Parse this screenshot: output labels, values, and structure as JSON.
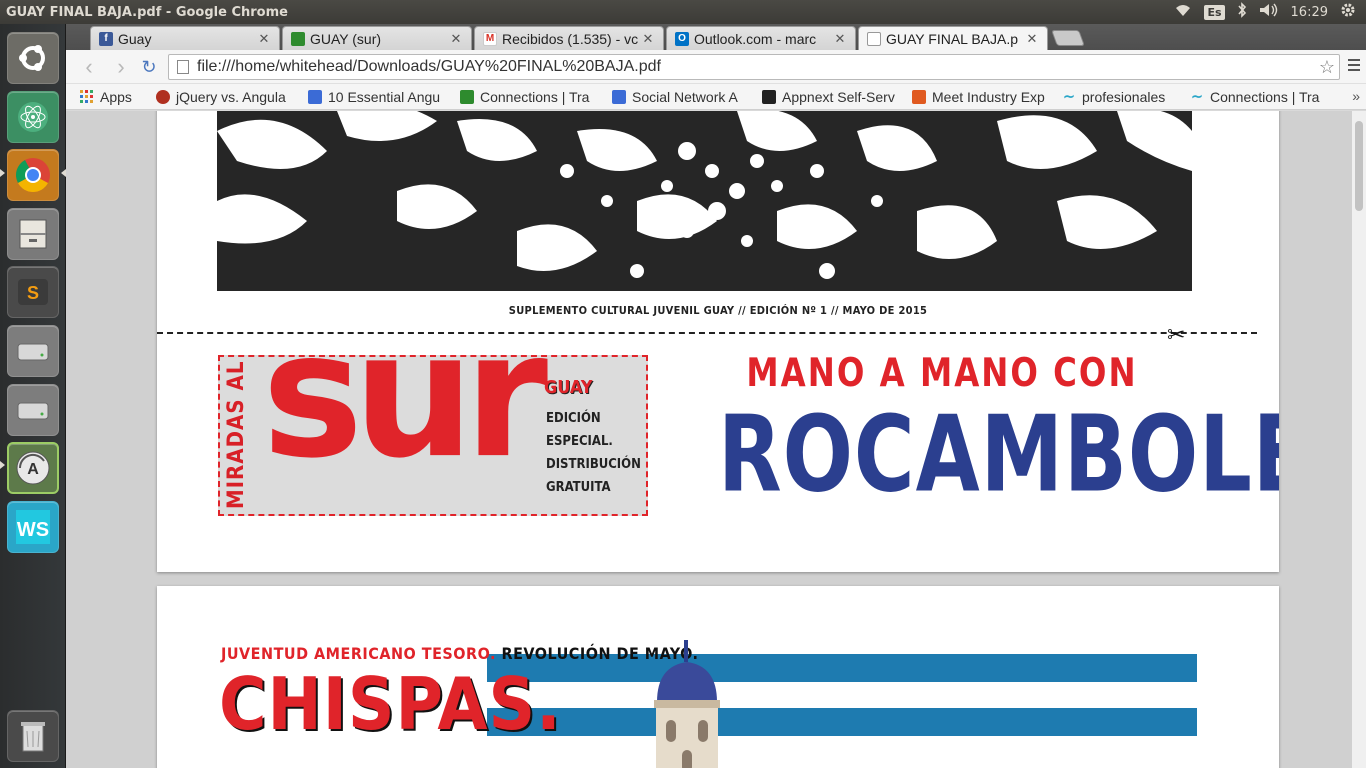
{
  "panel": {
    "window_title": "GUAY FINAL BAJA.pdf - Google Chrome",
    "keyboard_layout": "Es",
    "clock": "16:29",
    "indicator_icons": [
      "wifi-icon",
      "bluetooth-icon",
      "volume-icon",
      "settings-gear-icon"
    ]
  },
  "launcher": {
    "items": [
      {
        "name": "ubuntu-dash",
        "icon": "ubuntu-logo-icon"
      },
      {
        "name": "atom",
        "icon": "atom-icon"
      },
      {
        "name": "chrome",
        "icon": "chrome-icon"
      },
      {
        "name": "files",
        "icon": "file-cabinet-icon"
      },
      {
        "name": "sublime-text",
        "icon": "sublime-icon"
      },
      {
        "name": "drive-1",
        "icon": "hard-drive-icon"
      },
      {
        "name": "drive-2",
        "icon": "hard-drive-icon"
      },
      {
        "name": "software-updater",
        "icon": "updater-icon"
      },
      {
        "name": "webstorm",
        "icon": "webstorm-icon"
      },
      {
        "name": "trash",
        "icon": "trash-icon"
      }
    ]
  },
  "tabs": [
    {
      "label": "Guay",
      "favicon": "facebook-icon",
      "color": "#3b5998"
    },
    {
      "label": "GUAY (sur)",
      "favicon": "green-cube-icon",
      "color": "#2e8b2e"
    },
    {
      "label": "Recibidos (1.535) - vc",
      "favicon": "gmail-icon",
      "color": "#d93025"
    },
    {
      "label": "Outlook.com - marc",
      "favicon": "outlook-icon",
      "color": "#0072c6"
    },
    {
      "label": "GUAY FINAL BAJA.p",
      "favicon": "page-icon",
      "color": "#888888"
    }
  ],
  "toolbar": {
    "url": "file:///home/whitehead/Downloads/GUAY%20FINAL%20BAJA.pdf"
  },
  "bookmarks": [
    {
      "label": "Apps",
      "icon": "apps-grid-icon",
      "color": "#e0a030"
    },
    {
      "label": "jQuery vs. Angula",
      "icon": "jquery-icon",
      "color": "#b03020"
    },
    {
      "label": "10 Essential Angu",
      "icon": "toptal-icon",
      "color": "#3b6bd6"
    },
    {
      "label": "Connections | Tra",
      "icon": "green-cube-icon",
      "color": "#2e8b2e"
    },
    {
      "label": "Social Network A",
      "icon": "toptal-icon",
      "color": "#3b6bd6"
    },
    {
      "label": "Appnext Self-Serv",
      "icon": "appnext-icon",
      "color": "#222222"
    },
    {
      "label": "Meet Industry Exp",
      "icon": "meetup-icon",
      "color": "#e05a20"
    },
    {
      "label": "profesionales",
      "icon": "swirl-icon",
      "color": "#2aa6c8"
    },
    {
      "label": "Connections | Tra",
      "icon": "swirl-icon",
      "color": "#2aa6c8"
    }
  ],
  "pdf": {
    "page1": {
      "caption": "SUPLEMENTO CULTURAL JUVENIL GUAY // EDICIÓN Nº 1  // MAYO DE 2015",
      "miradas": "MIRADAS AL",
      "sur": "sur",
      "guay": "GUAY",
      "edicion_lines": [
        "EDICIÓN",
        "ESPECIAL.",
        "DISTRIBUCIÓN",
        "GRATUITA"
      ],
      "mano": "MANO A MANO CON",
      "rocambole": "ROCAMBOLE"
    },
    "page2": {
      "juventud_red": "JUVENTUD AMERICANO TESORO.",
      "juventud_black": "REVOLUCIÓN DE MAYO.",
      "chispas": "CHISPAS."
    },
    "colors": {
      "red": "#e0242a",
      "blue": "#2b3f8f",
      "stripe_blue": "#1e7bb0"
    }
  }
}
